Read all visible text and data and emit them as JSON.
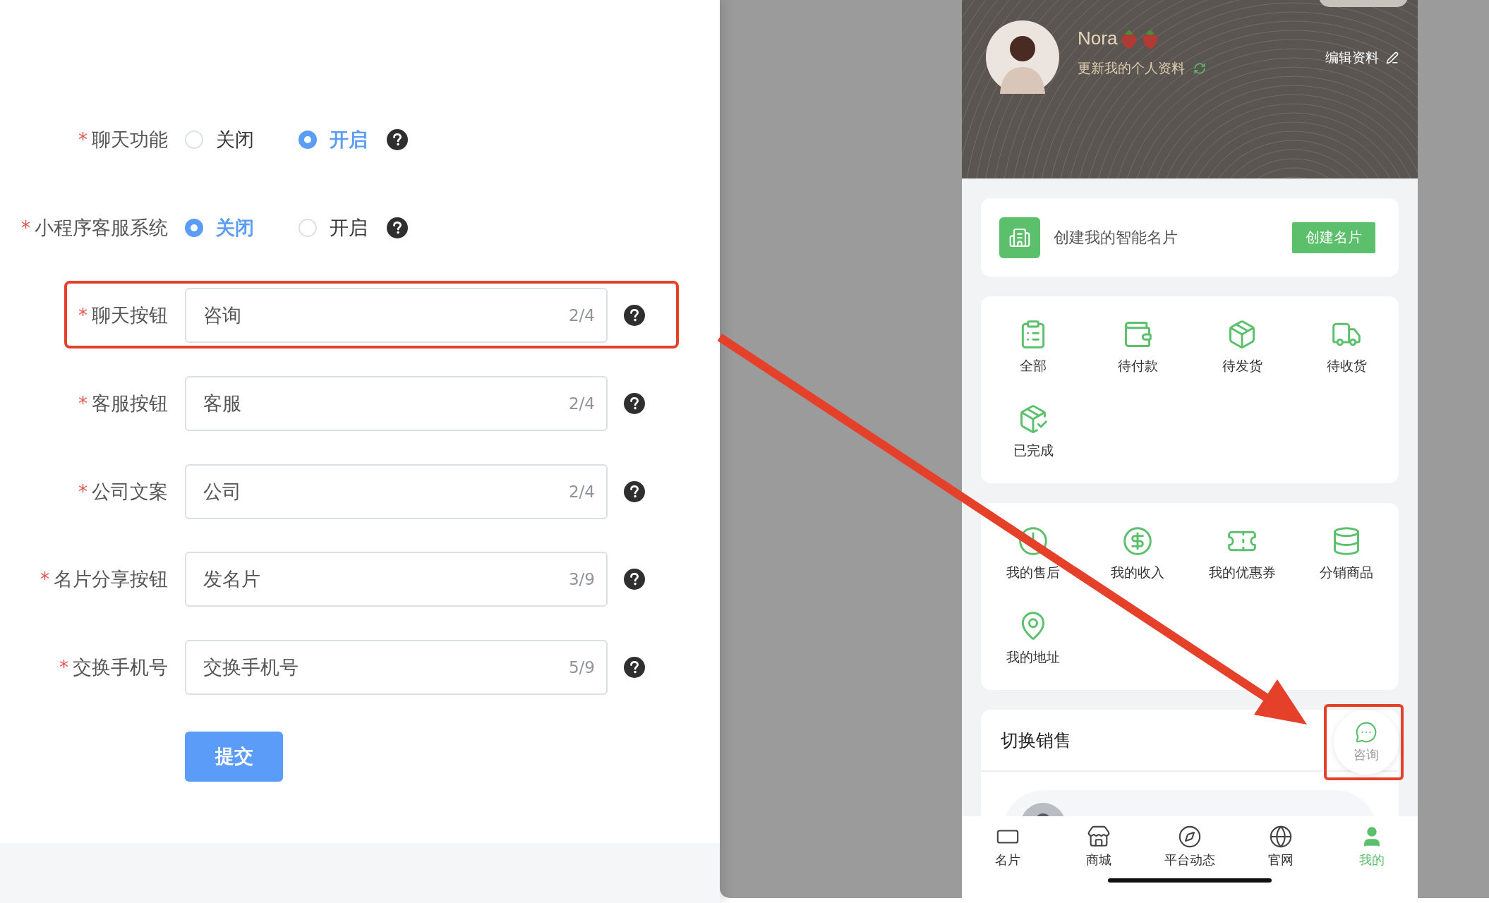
{
  "form": {
    "fields": [
      {
        "kind": "radio",
        "required_mark": "*",
        "label": "聊天功能",
        "options": [
          {
            "label": "关闭",
            "selected": false
          },
          {
            "label": "开启",
            "selected": true
          }
        ]
      },
      {
        "kind": "radio",
        "required_mark": "*",
        "label": "小程序客服系统",
        "options": [
          {
            "label": "关闭",
            "selected": true
          },
          {
            "label": "开启",
            "selected": false
          }
        ]
      },
      {
        "kind": "text",
        "required_mark": "*",
        "label": "聊天按钮",
        "value": "咨询",
        "counter": "2/4",
        "highlighted": true
      },
      {
        "kind": "text",
        "required_mark": "*",
        "label": "客服按钮",
        "value": "客服",
        "counter": "2/4",
        "highlighted": false
      },
      {
        "kind": "text",
        "required_mark": "*",
        "label": "公司文案",
        "value": "公司",
        "counter": "2/4",
        "highlighted": false
      },
      {
        "kind": "text",
        "required_mark": "*",
        "label": "名片分享按钮",
        "value": "发名片",
        "counter": "3/9",
        "highlighted": false
      },
      {
        "kind": "text",
        "required_mark": "*",
        "label": "交换手机号",
        "value": "交换手机号",
        "counter": "5/9",
        "highlighted": false
      }
    ],
    "submit": "提交"
  },
  "phone": {
    "profile": {
      "name": "Nora",
      "subtitle": "更新我的个人资料",
      "edit": "编辑资料"
    },
    "create_card": {
      "text": "创建我的智能名片",
      "button": "创建名片"
    },
    "orders": [
      {
        "label": "全部"
      },
      {
        "label": "待付款"
      },
      {
        "label": "待发货"
      },
      {
        "label": "待收货"
      },
      {
        "label": "已完成"
      }
    ],
    "services": [
      {
        "label": "我的售后"
      },
      {
        "label": "我的收入"
      },
      {
        "label": "我的优惠券"
      },
      {
        "label": "分销商品"
      },
      {
        "label": "我的地址"
      }
    ],
    "switch_sales": {
      "title": "切换销售"
    },
    "float_button": {
      "label": "咨询",
      "highlighted": true
    },
    "tabs": [
      {
        "label": "名片",
        "selected": false
      },
      {
        "label": "商城",
        "selected": false
      },
      {
        "label": "平台动态",
        "selected": false
      },
      {
        "label": "官网",
        "selected": false
      },
      {
        "label": "我的",
        "selected": true
      }
    ]
  }
}
